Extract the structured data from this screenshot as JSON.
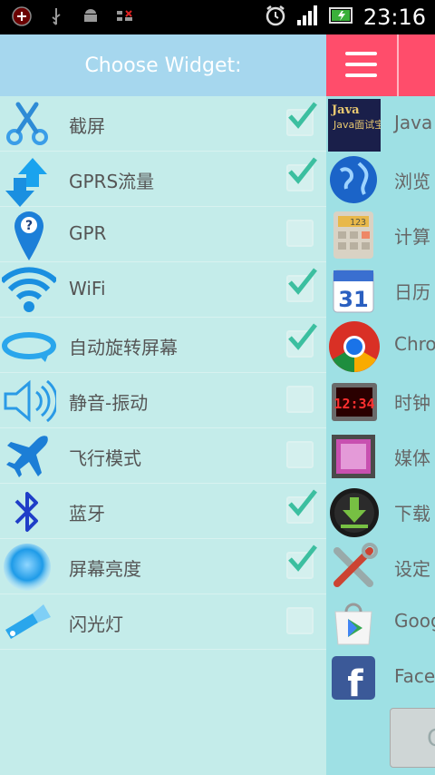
{
  "status": {
    "time": "23:16",
    "icons": [
      "record-icon",
      "usb-icon",
      "android-icon",
      "sim-icon",
      "alarm-icon",
      "signal-icon",
      "battery-icon"
    ]
  },
  "left_panel": {
    "title": "Choose Widget:",
    "items": [
      {
        "label": "截屏",
        "icon": "scissors-icon",
        "checked": true
      },
      {
        "label": "GPRS流量",
        "icon": "data-transfer-icon",
        "checked": true
      },
      {
        "label": "GPR",
        "icon": "location-pin-icon",
        "checked": false
      },
      {
        "label": "WiFi",
        "icon": "wifi-icon",
        "checked": true
      },
      {
        "label": "自动旋转屏幕",
        "icon": "rotate-icon",
        "checked": true
      },
      {
        "label": "静音-振动",
        "icon": "speaker-icon",
        "checked": false
      },
      {
        "label": "飞行模式",
        "icon": "airplane-icon",
        "checked": false
      },
      {
        "label": "蓝牙",
        "icon": "bluetooth-icon",
        "checked": true
      },
      {
        "label": "屏幕亮度",
        "icon": "brightness-icon",
        "checked": true
      },
      {
        "label": "闪光灯",
        "icon": "flashlight-icon",
        "checked": false
      }
    ]
  },
  "right_panel": {
    "apps": [
      {
        "label": "Java",
        "icon": "java-book-icon",
        "badge_text": "Java面试宝典"
      },
      {
        "label": "浏览",
        "icon": "browser-globe-icon"
      },
      {
        "label": "计算",
        "icon": "calculator-icon",
        "badge_text": "123"
      },
      {
        "label": "日历",
        "icon": "calendar-icon",
        "badge_text": "31"
      },
      {
        "label": "Chro",
        "icon": "chrome-icon"
      },
      {
        "label": "时钟",
        "icon": "clock-icon",
        "badge_text": "12:34"
      },
      {
        "label": "媒体",
        "icon": "gallery-icon"
      },
      {
        "label": "下载",
        "icon": "download-icon"
      },
      {
        "label": "设定",
        "icon": "settings-tools-icon"
      },
      {
        "label": "Goog",
        "icon": "play-store-icon"
      },
      {
        "label": "Face",
        "icon": "facebook-icon",
        "badge_text": "f"
      }
    ],
    "button_label": "C"
  }
}
